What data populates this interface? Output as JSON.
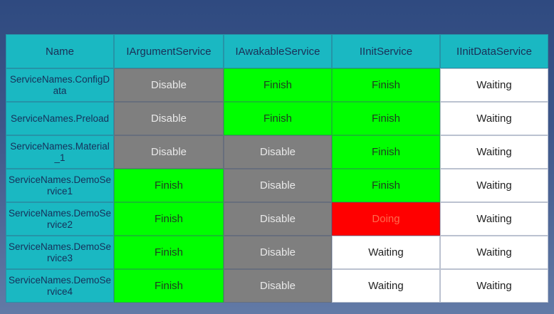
{
  "table": {
    "headers": [
      "Name",
      "IArgumentService",
      "IAwakableService",
      "IInitService",
      "IInitDataService"
    ],
    "rows": [
      {
        "name": "ServiceNames.ConfigData",
        "cells": [
          "Disable",
          "Finish",
          "Finish",
          "Waiting"
        ]
      },
      {
        "name": "ServiceNames.Preload",
        "cells": [
          "Disable",
          "Finish",
          "Finish",
          "Waiting"
        ]
      },
      {
        "name": "ServiceNames.Material_1",
        "cells": [
          "Disable",
          "Disable",
          "Finish",
          "Waiting"
        ]
      },
      {
        "name": "ServiceNames.DemoService1",
        "cells": [
          "Finish",
          "Disable",
          "Finish",
          "Waiting"
        ]
      },
      {
        "name": "ServiceNames.DemoService2",
        "cells": [
          "Finish",
          "Disable",
          "Doing",
          "Waiting"
        ]
      },
      {
        "name": "ServiceNames.DemoService3",
        "cells": [
          "Finish",
          "Disable",
          "Waiting",
          "Waiting"
        ]
      },
      {
        "name": "ServiceNames.DemoService4",
        "cells": [
          "Finish",
          "Disable",
          "Waiting",
          "Waiting"
        ]
      }
    ]
  },
  "status_colors": {
    "Disable": "#7f7f7f",
    "Finish": "#00ff00",
    "Waiting": "#ffffff",
    "Doing": "#ff0000",
    "header": "#1ab8c2"
  }
}
